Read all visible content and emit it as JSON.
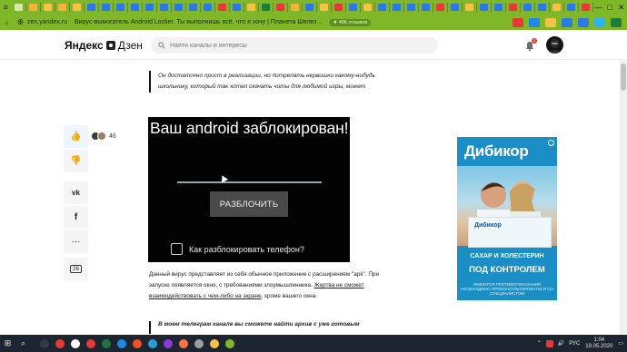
{
  "browser": {
    "window_controls": {
      "menu": "≡",
      "minimize": "—",
      "maximize": "□",
      "close": "✕"
    },
    "tab_icon_colors": [
      "#d4e9a4",
      "#f3b33d",
      "#f6c344",
      "#f3b33d",
      "#f6c344",
      "#2a7ae2",
      "#2a7ae2",
      "#2a7ae2",
      "#2a7ae2",
      "#2a7ae2",
      "#2a7ae2",
      "#2a7ae2",
      "#2a7ae2",
      "#2a7ae2",
      "#e53935",
      "#2a7ae2",
      "#f6c344",
      "#1a7f37",
      "#e53935",
      "#f3b33d",
      "#2a7ae2",
      "#f6c344",
      "#e53935",
      "#2a7ae2",
      "#f6c344",
      "#2a7ae2",
      "#2a7ae2",
      "#2a7ae2",
      "#2a7ae2",
      "#e53935",
      "#2a7ae2",
      "#f6c344",
      "#2a7ae2",
      "#2a7ae2",
      "#e53935",
      "#2a7ae2",
      "#2a7ae2",
      "#f6c344",
      "#2a7ae2",
      "#e53935"
    ],
    "address": {
      "domain": "zen.yandex.ru",
      "page_title": "Вирус-вымогатель Android Locker. Ты выполнишь всё, что я хочу | Планета Шелез...",
      "reviews_pill": "★ 486 отзывов",
      "ext_colors": [
        "#e53935",
        "#1e88e5",
        "#f6c344",
        "#2a7ae2",
        "#2a7ae2",
        "#29b6f6",
        "#1a7f37"
      ]
    }
  },
  "header": {
    "logo_yandex": "Яндекс",
    "logo_zen": "Дзен",
    "search_placeholder": "Найти каналы и интересы",
    "notifications_count": "5"
  },
  "social": {
    "likes_count": "46",
    "comments_count": "26"
  },
  "article": {
    "quote1": "Он достаточно прост в реализации, но потрепать нервишки какому-нибудь школьнику, который так хотел скачать читы для любимой игры, может",
    "lock_screen": {
      "title": "Ваш android заблокирован!",
      "unlock_button": "РАЗБЛОЧИТЬ",
      "checkbox_label": "Как разблокировать телефон?"
    },
    "paragraph_before": "Данный вирус представляет из себя обычное приложение с расширением \"apk\". При запуске появляется окно, с требованиями злоумышленника.",
    "paragraph_link": "Жертва не сможет взаимодействовать с чем-либо на экране",
    "paragraph_after": ", кроме вашего окна.",
    "quote2": "В моем телеграм канале вы сможете найти архив с уже готовым"
  },
  "ad": {
    "brand": "Дибикор",
    "box_label": "Дибикор",
    "line1": "САХАР И ХОЛЕСТЕРИН",
    "line2": "ПОД КОНТРОЛЕМ",
    "fine_print": "ИМЕЮТСЯ ПРОТИВОПОКАЗАНИЯ НЕОБХОДИМО ПРОКОНСУЛЬТИРОВАТЬСЯ СО СПЕЦИАЛИСТОМ"
  },
  "taskbar": {
    "app_icon_colors": [
      "#2f3b48",
      "#e53935",
      "#ffffff",
      "#e53935",
      "#217346",
      "#1e88e5",
      "#f4511e",
      "#2a9fd6",
      "#8e3ad6",
      "#ff7043",
      "#9e9e9e",
      "#f6c344",
      "#7fb729"
    ],
    "language": "РУС",
    "time": "1:04",
    "date": "19.05.2020"
  }
}
